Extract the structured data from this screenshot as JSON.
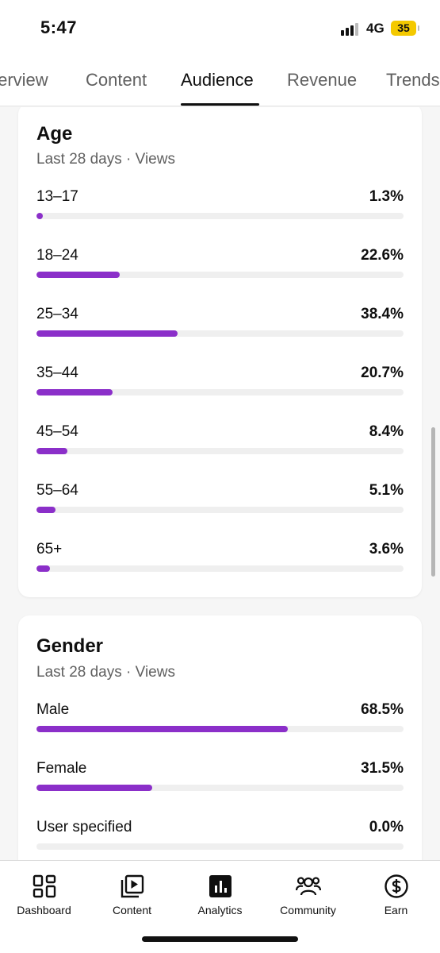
{
  "status": {
    "time": "5:47",
    "network": "4G",
    "battery": "35"
  },
  "tabs": [
    {
      "label": "Overview"
    },
    {
      "label": "Content"
    },
    {
      "label": "Audience",
      "active": true
    },
    {
      "label": "Revenue"
    },
    {
      "label": "Trends"
    }
  ],
  "age": {
    "title": "Age",
    "subtitle": "Last 28 days · Views",
    "rows": [
      {
        "label": "13–17",
        "value": "1.3%",
        "pct": 1.3
      },
      {
        "label": "18–24",
        "value": "22.6%",
        "pct": 22.6
      },
      {
        "label": "25–34",
        "value": "38.4%",
        "pct": 38.4
      },
      {
        "label": "35–44",
        "value": "20.7%",
        "pct": 20.7
      },
      {
        "label": "45–54",
        "value": "8.4%",
        "pct": 8.4
      },
      {
        "label": "55–64",
        "value": "5.1%",
        "pct": 5.1
      },
      {
        "label": "65+",
        "value": "3.6%",
        "pct": 3.6
      }
    ]
  },
  "gender": {
    "title": "Gender",
    "subtitle": "Last 28 days · Views",
    "rows": [
      {
        "label": "Male",
        "value": "68.5%",
        "pct": 68.5
      },
      {
        "label": "Female",
        "value": "31.5%",
        "pct": 31.5
      },
      {
        "label": "User specified",
        "value": "0.0%",
        "pct": 0.0
      }
    ]
  },
  "nav": [
    {
      "label": "Dashboard",
      "icon": "dashboard-icon"
    },
    {
      "label": "Content",
      "icon": "content-icon"
    },
    {
      "label": "Analytics",
      "icon": "analytics-icon",
      "active": true
    },
    {
      "label": "Community",
      "icon": "community-icon"
    },
    {
      "label": "Earn",
      "icon": "earn-icon"
    }
  ],
  "colors": {
    "accent": "#8b2fc9",
    "track": "#efefef",
    "battery": "#f4c900"
  }
}
